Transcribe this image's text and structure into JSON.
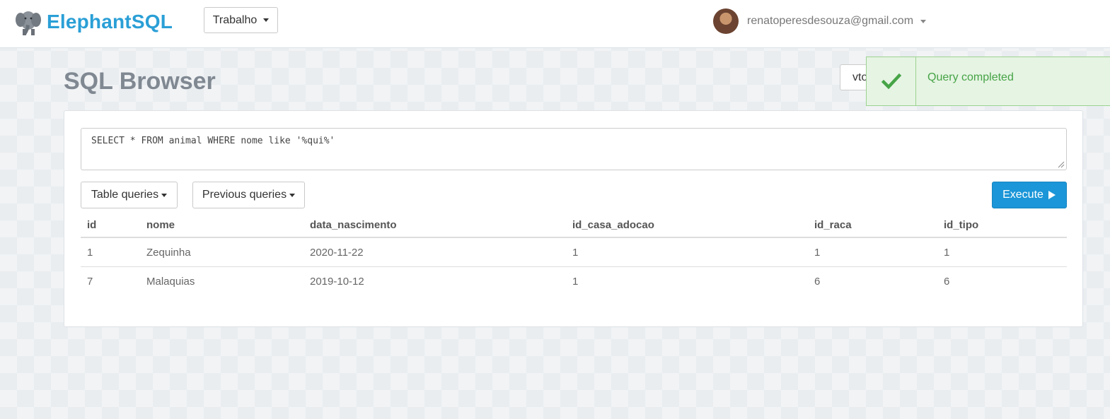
{
  "brand": {
    "name": "ElephantSQL"
  },
  "instance": {
    "label": "Trabalho"
  },
  "user": {
    "email": "renatoperesdesouza@gmail.com"
  },
  "page": {
    "title": "SQL Browser"
  },
  "db_select": {
    "value": "vto"
  },
  "toast": {
    "message": "Query completed",
    "icon": "check-icon",
    "color": "#46a447"
  },
  "editor": {
    "query": "SELECT * FROM animal WHERE nome like '%qui%'"
  },
  "buttons": {
    "table_queries": "Table queries",
    "previous_queries": "Previous queries",
    "execute": "Execute"
  },
  "results": {
    "columns": [
      "id",
      "nome",
      "data_nascimento",
      "id_casa_adocao",
      "id_raca",
      "id_tipo"
    ],
    "rows": [
      [
        "1",
        "Zequinha",
        "2020-11-22",
        "1",
        "1",
        "1"
      ],
      [
        "7",
        "Malaquias",
        "2019-10-12",
        "1",
        "6",
        "6"
      ]
    ]
  },
  "colors": {
    "accent": "#2a9fd6",
    "execute": "#1b96d8",
    "toast_bg": "#e6f4e3"
  }
}
